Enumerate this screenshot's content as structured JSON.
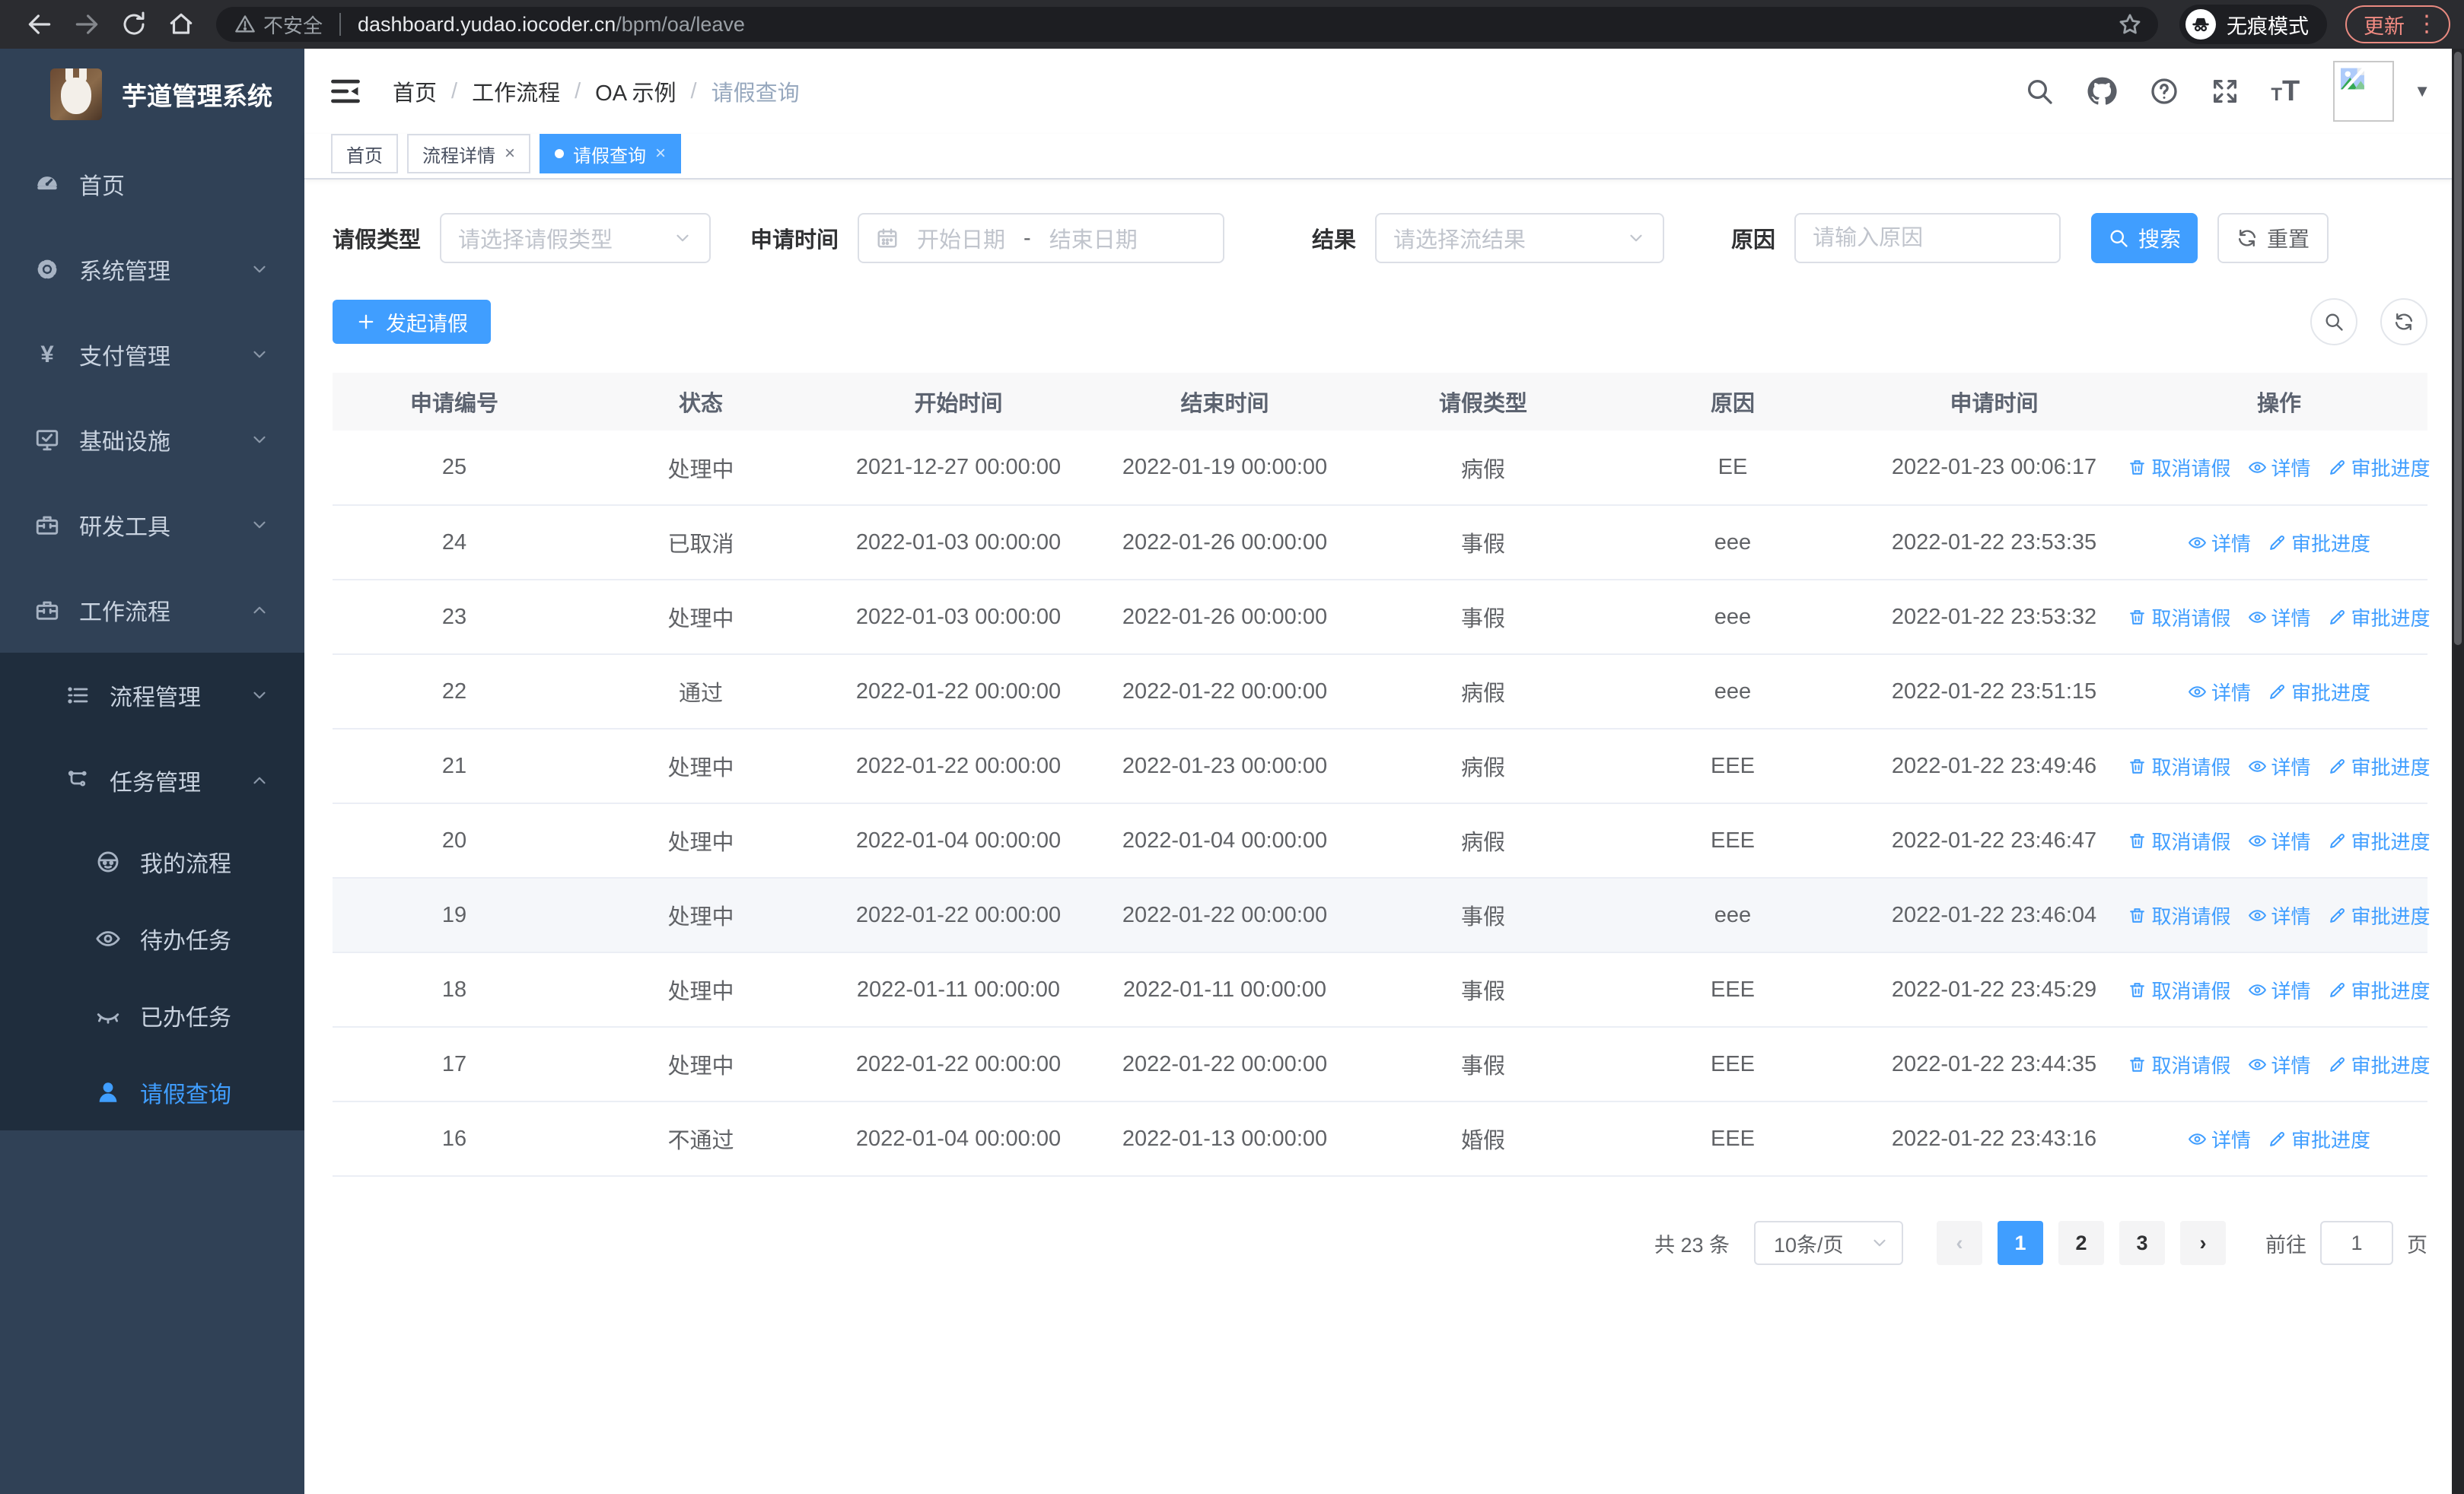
{
  "browser": {
    "security_label": "不安全",
    "url_host": "dashboard.yudao.iocoder.cn",
    "url_path": "/bpm/oa/leave",
    "incognito_label": "无痕模式",
    "update_label": "更新"
  },
  "colors": {
    "primary": "#409eff",
    "sidebar_bg": "#304156",
    "submenu_bg": "#1f2d3d",
    "update_accent": "#f28b82"
  },
  "sidebar": {
    "title": "芋道管理系统",
    "menu_top": [
      {
        "label": "首页",
        "icon": "dashboard-icon",
        "chevron": null
      },
      {
        "label": "系统管理",
        "icon": "gear-icon",
        "chevron": "down"
      },
      {
        "label": "支付管理",
        "icon": "yen-icon",
        "chevron": "down"
      },
      {
        "label": "基础设施",
        "icon": "monitor-icon",
        "chevron": "down"
      },
      {
        "label": "研发工具",
        "icon": "toolbox-icon",
        "chevron": "down"
      },
      {
        "label": "工作流程",
        "icon": "briefcase-icon",
        "chevron": "up"
      }
    ],
    "menu_sub": [
      {
        "label": "流程管理",
        "icon": "tree-icon",
        "chevron": "down",
        "level": 1,
        "active": false
      },
      {
        "label": "任务管理",
        "icon": "flow-icon",
        "chevron": "up",
        "level": 1,
        "active": false
      },
      {
        "label": "我的流程",
        "icon": "robot-icon",
        "chevron": null,
        "level": 2,
        "active": false
      },
      {
        "label": "待办任务",
        "icon": "eye-open-icon",
        "chevron": null,
        "level": 2,
        "active": false
      },
      {
        "label": "已办任务",
        "icon": "eye-closed-icon",
        "chevron": null,
        "level": 2,
        "active": false
      },
      {
        "label": "请假查询",
        "icon": "user-icon",
        "chevron": null,
        "level": 2,
        "active": true
      }
    ]
  },
  "header": {
    "breadcrumb": [
      "首页",
      "工作流程",
      "OA 示例",
      "请假查询"
    ]
  },
  "tabs": [
    {
      "label": "首页",
      "closable": false,
      "active": false
    },
    {
      "label": "流程详情",
      "closable": true,
      "active": false
    },
    {
      "label": "请假查询",
      "closable": true,
      "active": true
    }
  ],
  "filters": {
    "leave_type_label": "请假类型",
    "leave_type_placeholder": "请选择请假类型",
    "apply_time_label": "申请时间",
    "date_start_placeholder": "开始日期",
    "date_separator": "-",
    "date_end_placeholder": "结束日期",
    "result_label": "结果",
    "result_placeholder": "请选择流结果",
    "reason_label": "原因",
    "reason_placeholder": "请输入原因",
    "search_label": "搜索",
    "reset_label": "重置"
  },
  "toolbar": {
    "create_label": "发起请假"
  },
  "table": {
    "columns": [
      "申请编号",
      "状态",
      "开始时间",
      "结束时间",
      "请假类型",
      "原因",
      "申请时间",
      "操作"
    ],
    "action_labels": {
      "cancel": "取消请假",
      "detail": "详情",
      "progress": "审批进度"
    },
    "rows": [
      {
        "id": "25",
        "status": "处理中",
        "start": "2021-12-27 00:00:00",
        "end": "2022-01-19 00:00:00",
        "type": "病假",
        "reason": "EE",
        "applied": "2022-01-23 00:06:17",
        "cancellable": true,
        "highlight": false
      },
      {
        "id": "24",
        "status": "已取消",
        "start": "2022-01-03 00:00:00",
        "end": "2022-01-26 00:00:00",
        "type": "事假",
        "reason": "eee",
        "applied": "2022-01-22 23:53:35",
        "cancellable": false,
        "highlight": false
      },
      {
        "id": "23",
        "status": "处理中",
        "start": "2022-01-03 00:00:00",
        "end": "2022-01-26 00:00:00",
        "type": "事假",
        "reason": "eee",
        "applied": "2022-01-22 23:53:32",
        "cancellable": true,
        "highlight": false
      },
      {
        "id": "22",
        "status": "通过",
        "start": "2022-01-22 00:00:00",
        "end": "2022-01-22 00:00:00",
        "type": "病假",
        "reason": "eee",
        "applied": "2022-01-22 23:51:15",
        "cancellable": false,
        "highlight": false
      },
      {
        "id": "21",
        "status": "处理中",
        "start": "2022-01-22 00:00:00",
        "end": "2022-01-23 00:00:00",
        "type": "病假",
        "reason": "EEE",
        "applied": "2022-01-22 23:49:46",
        "cancellable": true,
        "highlight": false
      },
      {
        "id": "20",
        "status": "处理中",
        "start": "2022-01-04 00:00:00",
        "end": "2022-01-04 00:00:00",
        "type": "病假",
        "reason": "EEE",
        "applied": "2022-01-22 23:46:47",
        "cancellable": true,
        "highlight": false
      },
      {
        "id": "19",
        "status": "处理中",
        "start": "2022-01-22 00:00:00",
        "end": "2022-01-22 00:00:00",
        "type": "事假",
        "reason": "eee",
        "applied": "2022-01-22 23:46:04",
        "cancellable": true,
        "highlight": true
      },
      {
        "id": "18",
        "status": "处理中",
        "start": "2022-01-11 00:00:00",
        "end": "2022-01-11 00:00:00",
        "type": "事假",
        "reason": "EEE",
        "applied": "2022-01-22 23:45:29",
        "cancellable": true,
        "highlight": false
      },
      {
        "id": "17",
        "status": "处理中",
        "start": "2022-01-22 00:00:00",
        "end": "2022-01-22 00:00:00",
        "type": "事假",
        "reason": "EEE",
        "applied": "2022-01-22 23:44:35",
        "cancellable": true,
        "highlight": false
      },
      {
        "id": "16",
        "status": "不通过",
        "start": "2022-01-04 00:00:00",
        "end": "2022-01-13 00:00:00",
        "type": "婚假",
        "reason": "EEE",
        "applied": "2022-01-22 23:43:16",
        "cancellable": false,
        "highlight": false
      }
    ]
  },
  "pagination": {
    "total_label": "共 23 条",
    "page_size_label": "10条/页",
    "pages": [
      "1",
      "2",
      "3"
    ],
    "active_page": "1",
    "goto_label": "前往",
    "goto_value": "1",
    "page_unit": "页"
  }
}
